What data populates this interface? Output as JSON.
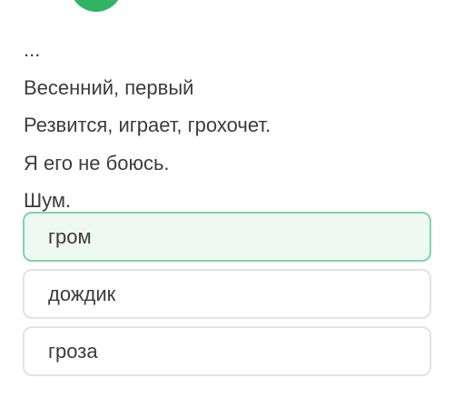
{
  "colors": {
    "accent_green": "#2fb464",
    "selected_border": "#7fd4a9",
    "selected_bg": "#eef9f3"
  },
  "riddle": {
    "lines": [
      "...",
      "Весенний, первый",
      "Резвится, играет, грохочет.",
      "Я его не боюсь.",
      "Шум."
    ]
  },
  "answers": {
    "options": [
      {
        "label": "гром",
        "selected": true
      },
      {
        "label": "дождик",
        "selected": false
      },
      {
        "label": "гроза",
        "selected": false
      }
    ]
  }
}
